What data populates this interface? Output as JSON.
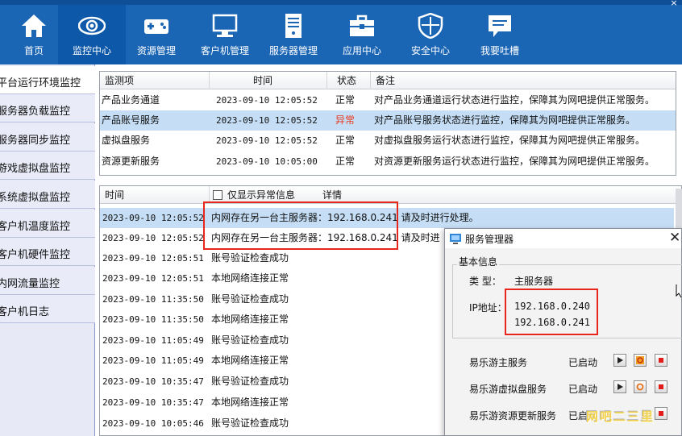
{
  "window": {
    "close_glyph": "×"
  },
  "nav": {
    "items": [
      {
        "label": "首页",
        "icon": "home-icon"
      },
      {
        "label": "监控中心",
        "icon": "eye-icon",
        "active": true
      },
      {
        "label": "资源管理",
        "icon": "gamepad-icon"
      },
      {
        "label": "客户机管理",
        "icon": "monitor-icon"
      },
      {
        "label": "服务器管理",
        "icon": "server-icon"
      },
      {
        "label": "应用中心",
        "icon": "toolbox-icon"
      },
      {
        "label": "安全中心",
        "icon": "shield-icon"
      },
      {
        "label": "我要吐槽",
        "icon": "feedback-icon"
      }
    ]
  },
  "sidebar": {
    "items": [
      {
        "label": "平台运行环境监控",
        "active": true
      },
      {
        "label": "服务器负载监控"
      },
      {
        "label": "服务器同步监控"
      },
      {
        "label": "游戏虚拟盘监控"
      },
      {
        "label": "系统虚拟盘监控"
      },
      {
        "label": "客户机温度监控"
      },
      {
        "label": "客户机硬件监控"
      },
      {
        "label": "内网流量监控"
      },
      {
        "label": "客户机日志"
      }
    ]
  },
  "monitor": {
    "headers": [
      "监测项",
      "时间",
      "状态",
      "备注"
    ],
    "rows": [
      {
        "item": "产品业务通道",
        "time": "2023-09-10 12:05:52",
        "status": "正常",
        "note": "对产品业务通道运行状态进行监控，保障其为网吧提供正常服务。"
      },
      {
        "item": "产品账号服务",
        "time": "2023-09-10 12:05:52",
        "status": "异常",
        "note": "对产品账号服务状态进行监控，保障其为网吧提供正常服务。",
        "selected": true
      },
      {
        "item": "虚拟盘服务",
        "time": "2023-09-10 12:05:52",
        "status": "正常",
        "note": "对虚拟盘服务运行状态进行监控，保障其为网吧提供正常服务。"
      },
      {
        "item": "资源更新服务",
        "time": "2023-09-10 10:05:00",
        "status": "正常",
        "note": "对资源更新服务运行状态进行监控，保障其为网吧提供正常服务。"
      }
    ],
    "colors": {
      "selected_bg": "#c5def5",
      "error": "#e8381d"
    }
  },
  "log": {
    "headers": {
      "time": "时间",
      "filter": "仅显示异常信息",
      "detail": "详情"
    },
    "rows": [
      {
        "time": "2023-09-10 12:05:52",
        "detail": "内网存在另一台主服务器：192.168.0.241 请及时进行处理。",
        "selected": true
      },
      {
        "time": "2023-09-10 12:05:52",
        "detail": "内网存在另一台主服务器：192.168.0.241 请及时进"
      },
      {
        "time": "2023-09-10 12:05:51",
        "detail": "账号验证检查成功"
      },
      {
        "time": "2023-09-10 12:05:51",
        "detail": "本地网络连接正常"
      },
      {
        "time": "2023-09-10 11:35:50",
        "detail": "账号验证检查成功"
      },
      {
        "time": "2023-09-10 11:35:50",
        "detail": "本地网络连接正常"
      },
      {
        "time": "2023-09-10 11:05:49",
        "detail": "账号验证检查成功"
      },
      {
        "time": "2023-09-10 11:05:49",
        "detail": "本地网络连接正常"
      },
      {
        "time": "2023-09-10 10:35:47",
        "detail": "账号验证检查成功"
      },
      {
        "time": "2023-09-10 10:35:47",
        "detail": "本地网络连接正常"
      },
      {
        "time": "2023-09-10 10:05:46",
        "detail": "账号验证检查成功"
      }
    ]
  },
  "dialog": {
    "title": "服务管理器",
    "close_glyph": "✕",
    "group_title": "基本信息",
    "type_label": "类  型：",
    "type_value": "主服务器",
    "ip_label": "IP地址：",
    "ips": [
      "192.168.0.240",
      "192.168.0.241"
    ],
    "services": [
      {
        "name": "易乐游主服务",
        "status": "已启动"
      },
      {
        "name": "易乐游虚拟盘服务",
        "status": "已启动"
      },
      {
        "name": "易乐游资源更新服务",
        "status": "已启"
      }
    ]
  },
  "watermark": "网吧二三里",
  "colors": {
    "nav_bg": "#1b65b5",
    "nav_active": "#0d58a8",
    "highlight_box": "#e8261c"
  }
}
